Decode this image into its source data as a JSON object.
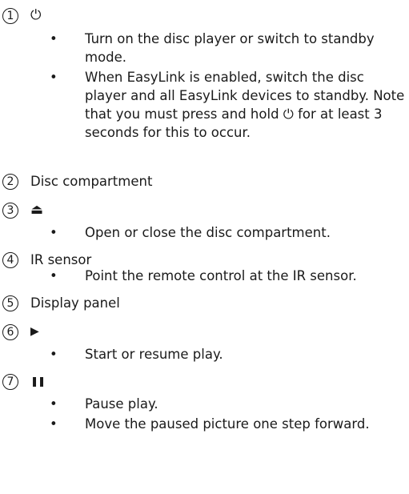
{
  "items": [
    {
      "number": "1",
      "icon": "power-icon",
      "glyph": "⏻",
      "bullets": [
        "Turn on the disc player or switch to standby mode.",
        "When EasyLink is enabled, switch the disc player and all EasyLink devices to standby. Note that you must press and hold ⏻ for at least 3 seconds for this to occur."
      ]
    },
    {
      "number": "2",
      "heading": "Disc compartment"
    },
    {
      "number": "3",
      "icon": "eject-icon",
      "glyph": "⏏",
      "bullets": [
        "Open or close the disc compartment."
      ]
    },
    {
      "number": "4",
      "heading": "IR sensor",
      "bullets": [
        "Point the remote control at the IR sensor."
      ]
    },
    {
      "number": "5",
      "heading": "Display panel"
    },
    {
      "number": "6",
      "icon": "play-icon",
      "glyph": "▶",
      "bullets": [
        "Start or resume play."
      ]
    },
    {
      "number": "7",
      "icon": "pause-icon",
      "glyph": "❚❚",
      "bullets": [
        "Pause play.",
        "Move the paused picture one step forward."
      ]
    }
  ],
  "bullet_char": "•"
}
